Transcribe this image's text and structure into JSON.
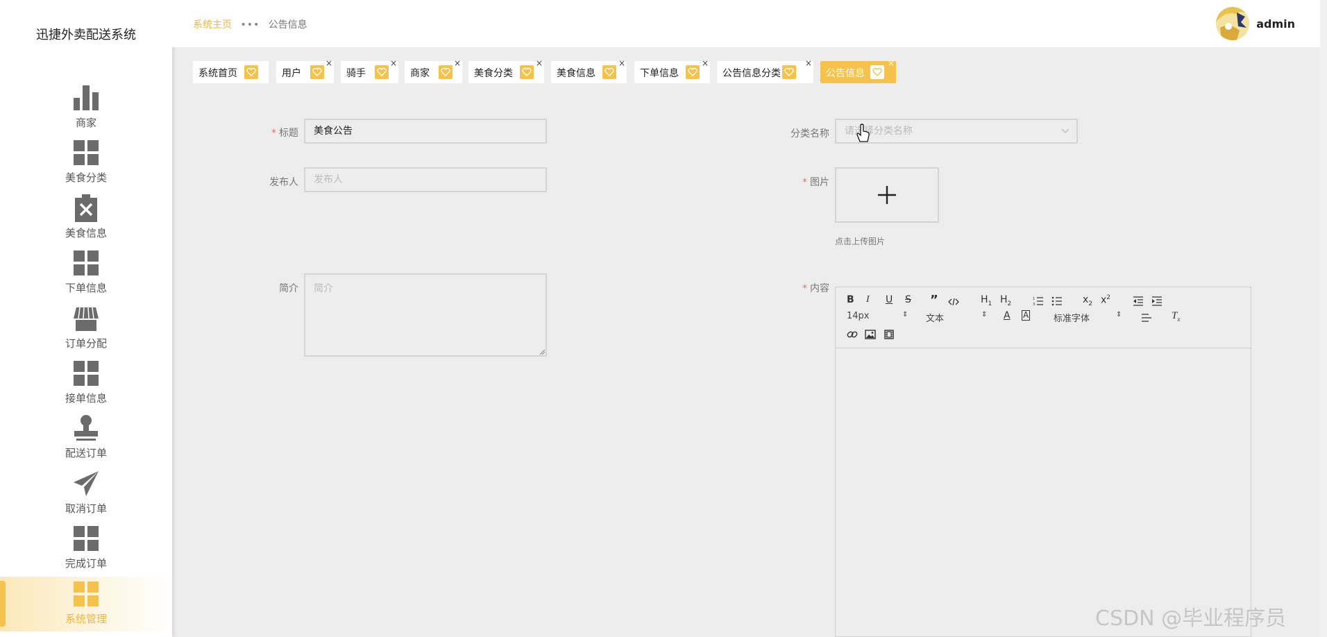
{
  "app": {
    "title": "迅捷外卖配送系统"
  },
  "sidebar": {
    "items": [
      {
        "label": "商家",
        "icon": "bar-chart-icon"
      },
      {
        "label": "美食分类",
        "icon": "grid-icon"
      },
      {
        "label": "美食信息",
        "icon": "delete-bin-icon"
      },
      {
        "label": "下单信息",
        "icon": "grid-icon"
      },
      {
        "label": "订单分配",
        "icon": "store-icon"
      },
      {
        "label": "接单信息",
        "icon": "grid-icon"
      },
      {
        "label": "配送订单",
        "icon": "stamp-icon"
      },
      {
        "label": "取消订单",
        "icon": "paper-plane-icon"
      },
      {
        "label": "完成订单",
        "icon": "grid-icon"
      },
      {
        "label": "系统管理",
        "icon": "grid-icon",
        "active": true
      }
    ]
  },
  "header": {
    "breadcrumb_home": "系统主页",
    "breadcrumb_dots": "•••",
    "breadcrumb_current": "公告信息",
    "username": "admin"
  },
  "tabs": [
    {
      "label": "系统首页"
    },
    {
      "label": "用户",
      "close": "×"
    },
    {
      "label": "骑手",
      "close": "×"
    },
    {
      "label": "商家",
      "close": "×"
    },
    {
      "label": "美食分类",
      "close": "×"
    },
    {
      "label": "美食信息",
      "close": "×"
    },
    {
      "label": "下单信息",
      "close": "×"
    },
    {
      "label": "公告信息分类",
      "close": "×"
    },
    {
      "label": "公告信息",
      "close": "×",
      "active": true
    }
  ],
  "form": {
    "title": {
      "required": "*",
      "label": "标题",
      "value": "美食公告"
    },
    "category": {
      "label": "分类名称",
      "placeholder": "请选择分类名称"
    },
    "publisher": {
      "label": "发布人",
      "placeholder": "发布人"
    },
    "image": {
      "required": "*",
      "label": "图片",
      "plus": "+",
      "tip": "点击上传图片"
    },
    "summary": {
      "label": "简介",
      "placeholder": "简介"
    },
    "content": {
      "required": "*",
      "label": "内容"
    }
  },
  "editor": {
    "font_size": "14px",
    "header_select": "文本",
    "font_family": "标准字体",
    "select_arrow": "⇕"
  },
  "colors": {
    "accent": "#f5c24b",
    "accent_text": "#f0b63c",
    "required": "#f56c6c"
  },
  "watermark": "CSDN @毕业程序员"
}
